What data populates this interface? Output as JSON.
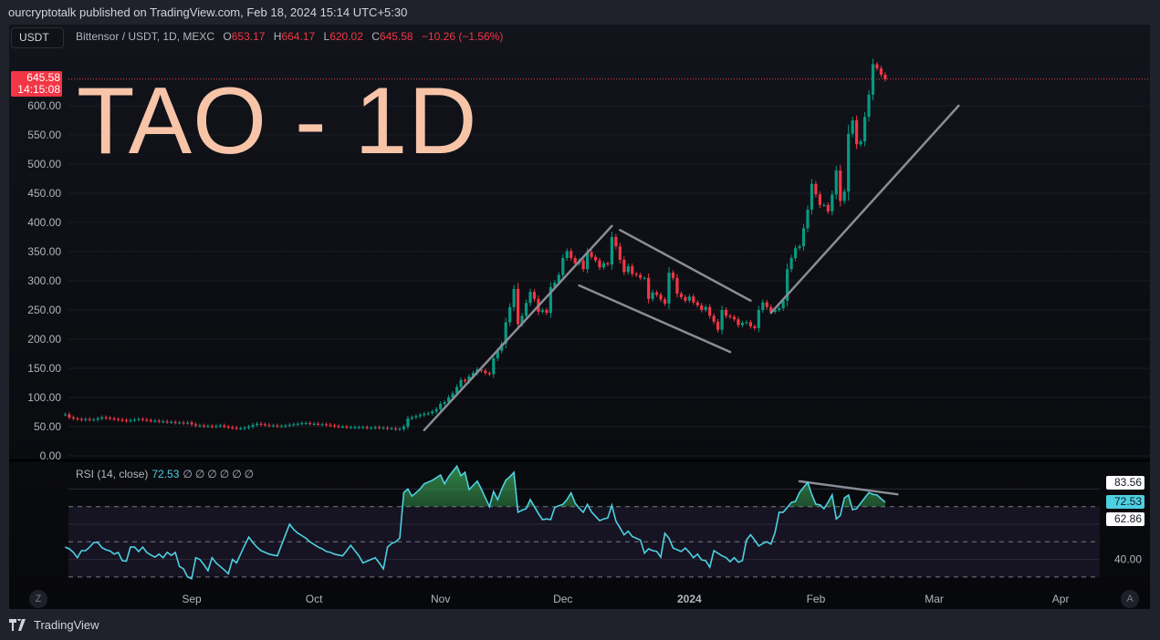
{
  "header": {
    "publish_line": "ourcryptotalk published on TradingView.com, Feb 18, 2024 15:14 UTC+5:30"
  },
  "legend": {
    "currency_button": "USDT",
    "symbol": "Bittensor / USDT, 1D, MEXC",
    "o_label": "O",
    "o": "653.17",
    "h_label": "H",
    "h": "664.17",
    "l_label": "L",
    "l": "620.02",
    "c_label": "C",
    "c": "645.58",
    "change": "−10.26 (−1.56%)"
  },
  "overlay_title": "TAO - 1D",
  "last_price_tag": {
    "price": "645.58",
    "countdown": "14:15:08"
  },
  "rsi_legend": {
    "name": "RSI (14, close)",
    "value": "72.53",
    "hidden_values": "∅∅∅∅∅∅"
  },
  "rsi_tags": {
    "upper": "83.56",
    "current": "72.53",
    "lower": "62.86"
  },
  "buttons": {
    "z": "Z",
    "a": "A"
  },
  "footer": {
    "brand": "TradingView"
  },
  "colors": {
    "up": "#089981",
    "down": "#f23645",
    "rsi_line": "#4dd0e1",
    "overlay_title": "#f8c4a8",
    "drawings": "#8a8d96"
  },
  "chart_data": [
    {
      "type": "candlestick",
      "symbol": "Bittensor / USDT",
      "interval": "1D",
      "y_ticks": [
        "0.00",
        "50.00",
        "100.00",
        "150.00",
        "200.00",
        "250.00",
        "300.00",
        "350.00",
        "400.00",
        "450.00",
        "500.00",
        "550.00",
        "600.00"
      ],
      "ylim": [
        0,
        680
      ],
      "y_axis_side": "left",
      "x_ticks": [
        {
          "label": "Sep",
          "date": "2023-09-01"
        },
        {
          "label": "Oct",
          "date": "2023-10-01"
        },
        {
          "label": "Nov",
          "date": "2023-11-01"
        },
        {
          "label": "Dec",
          "date": "2023-12-01"
        },
        {
          "label": "2024",
          "date": "2024-01-01",
          "bold": true
        },
        {
          "label": "Feb",
          "date": "2024-02-01"
        },
        {
          "label": "Mar",
          "date": "2024-03-01"
        },
        {
          "label": "Apr",
          "date": "2024-04-01"
        }
      ],
      "last_price": 645.58,
      "grid": true,
      "daily_closes_by_month": {
        "2023-08": [
          71,
          66,
          64,
          63,
          62,
          63,
          62,
          62,
          64,
          66,
          65,
          64,
          63,
          62,
          61,
          60,
          61,
          62,
          63,
          62,
          61,
          60,
          60,
          59,
          59,
          58,
          58,
          57,
          57,
          56,
          57
        ],
        "2023-09": [
          54,
          52,
          52,
          51,
          51,
          50,
          51,
          52,
          50,
          49,
          48,
          47,
          47,
          48,
          50,
          53,
          55,
          54,
          53,
          52,
          52,
          51,
          51,
          52,
          53,
          54,
          55,
          56,
          56,
          55
        ],
        "2023-10": [
          55,
          54,
          54,
          53,
          52,
          51,
          50,
          50,
          49,
          49,
          49,
          49,
          49,
          48,
          48,
          49,
          48,
          48,
          47,
          47,
          46,
          46,
          50,
          64,
          66,
          68,
          70,
          72,
          73,
          76,
          80
        ],
        "2023-11": [
          89,
          92,
          100,
          107,
          118,
          130,
          128,
          136,
          142,
          148,
          146,
          142,
          140,
          167,
          180,
          192,
          229,
          255,
          286,
          226,
          240,
          262,
          281,
          269,
          247,
          250,
          245,
          289,
          297,
          310
        ],
        "2023-12": [
          339,
          351,
          339,
          330,
          335,
          320,
          349,
          341,
          335,
          323,
          330,
          328,
          375,
          359,
          336,
          315,
          325,
          312,
          310,
          305,
          305,
          269,
          280,
          276,
          268,
          261,
          314,
          305,
          278,
          272,
          266
        ],
        "2024-01": [
          273,
          263,
          258,
          250,
          255,
          240,
          230,
          216,
          250,
          240,
          238,
          234,
          224,
          228,
          229,
          222,
          219,
          250,
          263,
          255,
          247,
          250,
          253,
          266,
          320,
          339,
          356,
          359,
          390,
          422,
          466
        ],
        "2024-02": [
          448,
          430,
          430,
          419,
          448,
          489,
          437,
          453,
          552,
          575,
          534,
          539,
          581,
          619,
          671,
          664,
          653.17,
          645.58
        ]
      },
      "drawings": [
        {
          "type": "trend_line",
          "from": [
            "2023-10-28",
            44
          ],
          "to": [
            "2023-12-13",
            394
          ]
        },
        {
          "type": "trend_line",
          "from": [
            "2023-12-15",
            387
          ],
          "to": [
            "2024-01-16",
            266
          ]
        },
        {
          "type": "trend_line",
          "from": [
            "2023-12-05",
            292
          ],
          "to": [
            "2024-01-11",
            178
          ]
        },
        {
          "type": "trend_line",
          "from": [
            "2024-01-21",
            245
          ],
          "to": [
            "2024-03-07",
            600
          ]
        }
      ]
    },
    {
      "type": "line",
      "series": [
        {
          "name": "RSI (14, close)"
        }
      ],
      "y_ticks": [
        "40.00"
      ],
      "y_axis_side": "right",
      "levels": [
        70,
        50,
        30
      ],
      "overbought_fill": true,
      "ylim": [
        25,
        95
      ],
      "daily_values_by_month": {
        "2023-08": [
          47,
          46,
          44,
          41,
          45,
          45,
          47,
          49.6,
          49.6,
          46.7,
          45.5,
          44.8,
          43,
          44,
          39.3,
          39,
          47,
          47,
          44.5,
          47,
          44,
          42.5,
          41.3,
          43,
          41,
          44,
          42.3,
          44,
          36,
          34.6,
          30
        ],
        "2023-09": [
          29,
          41,
          40,
          37,
          33.6,
          41,
          38,
          36,
          34,
          31.8,
          40,
          38,
          43,
          48,
          52.7,
          49.6,
          47,
          45,
          44,
          43,
          42.5,
          42,
          48,
          54,
          60,
          57,
          55,
          53.5,
          52,
          50
        ],
        "2023-10": [
          48.5,
          47,
          46,
          44.5,
          44,
          43,
          42.5,
          42,
          45,
          48,
          45,
          42,
          38,
          39,
          40,
          41,
          38,
          34.6,
          47,
          49,
          50,
          52,
          78,
          80,
          76,
          78,
          80,
          83,
          84,
          85,
          86.5
        ],
        "2023-11": [
          88,
          83,
          87,
          90,
          93,
          87.6,
          89.5,
          79.7,
          82,
          84.5,
          80,
          75,
          70,
          78.6,
          74,
          80,
          85,
          87,
          89.5,
          66.8,
          68,
          68.8,
          74,
          70,
          66,
          62.6,
          63,
          62.6,
          69.5,
          70.5
        ],
        "2023-12": [
          71.3,
          74,
          77.8,
          72,
          69,
          66.8,
          71.3,
          67,
          64.5,
          62,
          63,
          63.6,
          70.8,
          61.7,
          58,
          54,
          56,
          53,
          52,
          51,
          43.6,
          46,
          45,
          44.5,
          41.3,
          54.8,
          52,
          46.5,
          45.5,
          44.5,
          46.5
        ],
        "2024-01": [
          44,
          41,
          43,
          39.7,
          39.3,
          35.6,
          45,
          43.5,
          42,
          41,
          38.7,
          41,
          38.4,
          39.3,
          51,
          54,
          51,
          47.6,
          49,
          50,
          48.7,
          55.3,
          66.8,
          66.8,
          69.5,
          72.4,
          73,
          78,
          81,
          83.8,
          77
        ],
        "2024-02": [
          71.4,
          71,
          68.8,
          72.5,
          76.7,
          63,
          65,
          75,
          76.6,
          68.3,
          68.8,
          72,
          75,
          78,
          77,
          76.6,
          74.5,
          72.53
        ]
      },
      "drawings": [
        {
          "type": "trend_line",
          "from": [
            "2024-01-28",
            84.4
          ],
          "to": [
            "2024-02-21",
            77
          ]
        }
      ]
    }
  ]
}
